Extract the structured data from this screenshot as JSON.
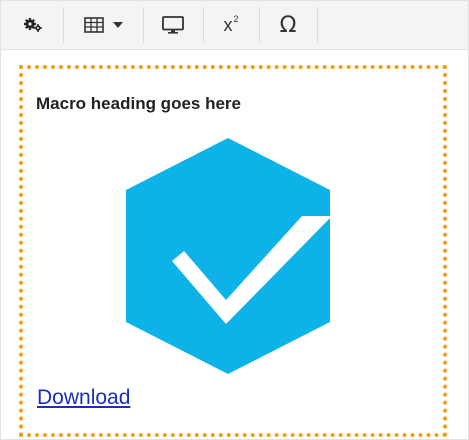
{
  "toolbar": {
    "buttons": [
      {
        "icon": "gears-icon",
        "label": ""
      },
      {
        "icon": "table-icon",
        "label": ""
      },
      {
        "icon": "monitor-icon",
        "label": ""
      },
      {
        "icon": "superscript-icon",
        "label": "x",
        "sup": "2"
      },
      {
        "icon": "omega-icon",
        "label": "Ω"
      }
    ]
  },
  "macro": {
    "heading": "Macro heading goes here",
    "logo_icon": "checkmark-box-icon",
    "logo_color": "#0db3e8",
    "border_color": "#f59c12",
    "link_label": "Download",
    "link_color": "#1a2fb5"
  }
}
